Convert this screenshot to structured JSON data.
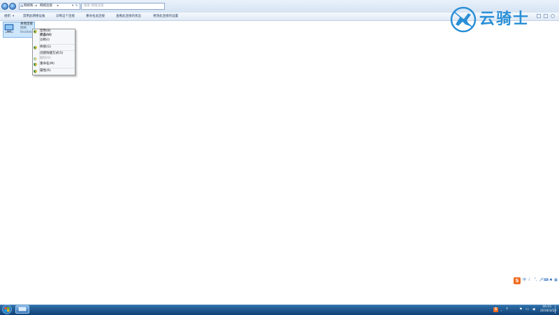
{
  "window": {
    "breadcrumb": [
      "网络和...",
      "网络连接"
    ],
    "search_placeholder": "搜索 网络连接"
  },
  "command_bar": {
    "items": [
      "组织",
      "禁用此网络设备",
      "诊断这个连接",
      "重命名此连接",
      "查看此连接的状态",
      "更改此连接的设置"
    ]
  },
  "connection": {
    "name": "本地连接",
    "status": "网络",
    "adapter": "Realtek"
  },
  "context_menu": {
    "items": [
      {
        "label": "禁用(B)",
        "bold": false,
        "disabled": false,
        "shield": true
      },
      {
        "label": "状态(U)",
        "bold": true,
        "disabled": false,
        "shield": false
      },
      {
        "label": "诊断(I)",
        "bold": false,
        "disabled": false,
        "shield": false
      },
      {
        "label": "桥接(G)",
        "bold": false,
        "disabled": false,
        "shield": true
      },
      {
        "label": "创建快捷方式(S)",
        "bold": false,
        "disabled": false,
        "shield": false
      },
      {
        "label": "删除(D)",
        "bold": false,
        "disabled": true,
        "shield": true
      },
      {
        "label": "重命名(M)",
        "bold": false,
        "disabled": false,
        "shield": true
      },
      {
        "label": "属性(R)",
        "bold": false,
        "disabled": false,
        "shield": true
      }
    ]
  },
  "watermark": {
    "text": "云骑士",
    "color": "#2a8fd6"
  },
  "ime_toolbar": {
    "logo": "S",
    "items": [
      "中",
      "moon-icon",
      "punct-icon",
      "mic-icon",
      "keyboard-icon",
      "shirt-icon",
      "grid-icon"
    ]
  },
  "taskbar": {
    "tray_icons": [
      "sogou-icon",
      "speaker-icon",
      "network-icon",
      "flag-icon"
    ],
    "tray_ime_label": "S",
    "time": "16:15",
    "date": "2019/3/18"
  },
  "colors": {
    "accent": "#2c6fbf",
    "selection": "#cde6fb",
    "taskbar": "#1a4f87"
  }
}
